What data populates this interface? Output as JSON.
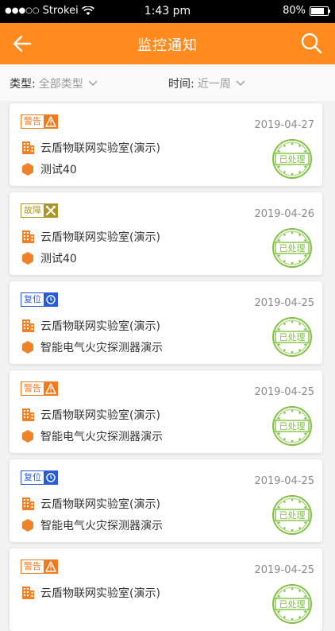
{
  "status_bar": {
    "carrier": "Strokei",
    "time": "1:43 pm",
    "battery": "80%",
    "battery_level": 0.8
  },
  "header": {
    "title": "监控通知"
  },
  "filters": {
    "type_label": "类型:",
    "type_value": "全部类型",
    "time_label": "时间:",
    "time_value": "近一周"
  },
  "colors": {
    "accent": "#ff8a1e",
    "warning": "#f07a1e",
    "fault": "#a89628",
    "reset": "#2a5bd7",
    "stamp": "#7fc243"
  },
  "notifications": [
    {
      "badge": "警告",
      "badge_kind": "warning",
      "date": "2019-04-27",
      "location": "云盾物联网实验室(演示)",
      "device": "测试40",
      "status": "已处理"
    },
    {
      "badge": "故障",
      "badge_kind": "fault",
      "date": "2019-04-26",
      "location": "云盾物联网实验室(演示)",
      "device": "测试40",
      "status": "已处理"
    },
    {
      "badge": "复位",
      "badge_kind": "reset",
      "date": "2019-04-25",
      "location": "云盾物联网实验室(演示)",
      "device": "智能电气火灾探测器演示",
      "status": "已处理"
    },
    {
      "badge": "警告",
      "badge_kind": "warning",
      "date": "2019-04-25",
      "location": "云盾物联网实验室(演示)",
      "device": "智能电气火灾探测器演示",
      "status": "已处理"
    },
    {
      "badge": "复位",
      "badge_kind": "reset",
      "date": "2019-04-25",
      "location": "云盾物联网实验室(演示)",
      "device": "智能电气火灾探测器演示",
      "status": "已处理"
    },
    {
      "badge": "警告",
      "badge_kind": "warning",
      "date": "2019-04-25",
      "location": "云盾物联网实验室(演示)",
      "device": "",
      "status": "已处理"
    }
  ]
}
